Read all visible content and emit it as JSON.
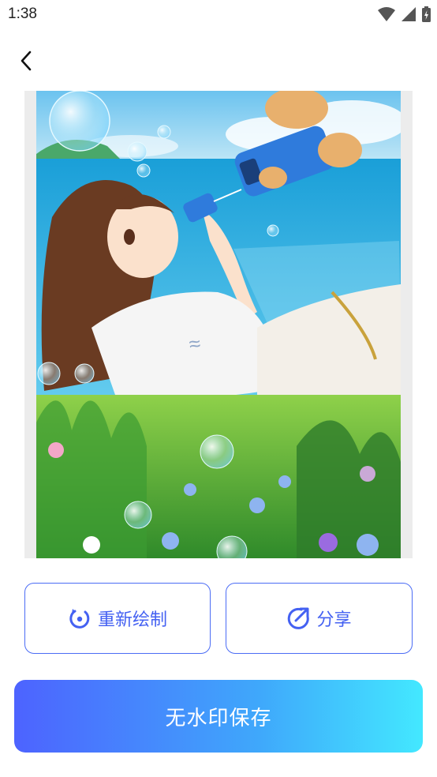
{
  "status_bar": {
    "time": "1:38",
    "icons": [
      "wifi-icon",
      "signal-icon",
      "battery-charging-icon"
    ]
  },
  "nav": {
    "back_icon": "chevron-left-icon"
  },
  "image": {
    "description_name": "generated-artwork"
  },
  "actions": {
    "redraw_label": "重新绘制",
    "redraw_icon": "redo-circle-icon",
    "share_label": "分享",
    "share_icon": "share-circle-icon",
    "save_label": "无水印保存"
  },
  "colors": {
    "accent": "#4461f2",
    "gradient_start": "#4d63ff",
    "gradient_end": "#43e8ff"
  }
}
